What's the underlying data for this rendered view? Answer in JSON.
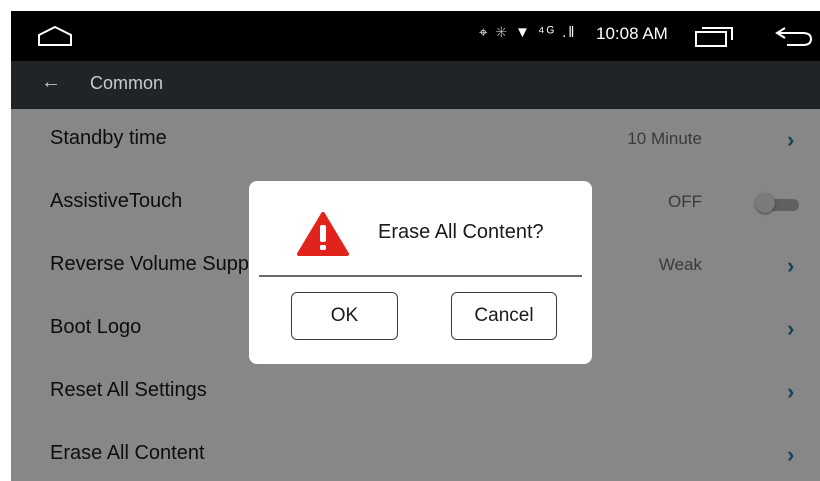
{
  "status_bar": {
    "icons": "⌖ ✳ ▼ ⁴ᴳ .‖",
    "time": "10:08 AM"
  },
  "title_bar": {
    "back_glyph": "←",
    "title": "Common"
  },
  "settings": [
    {
      "label": "Standby time",
      "value": "10 Minute",
      "control": "chevron"
    },
    {
      "label": "AssistiveTouch",
      "value": "OFF",
      "control": "toggle"
    },
    {
      "label": "Reverse Volume Support",
      "value": "Weak",
      "control": "chevron"
    },
    {
      "label": "Boot Logo",
      "value": "",
      "control": "chevron"
    },
    {
      "label": "Reset All Settings",
      "value": "",
      "control": "chevron"
    },
    {
      "label": "Erase All Content",
      "value": "",
      "control": "chevron"
    }
  ],
  "chevron_glyph": "›",
  "dialog": {
    "message": "Erase All Content?",
    "ok_label": "OK",
    "cancel_label": "Cancel",
    "warning_color": "#e0241b"
  },
  "colors": {
    "accent": "#2c7fa8",
    "status_bar": "#000000",
    "title_bar": "#212426"
  }
}
